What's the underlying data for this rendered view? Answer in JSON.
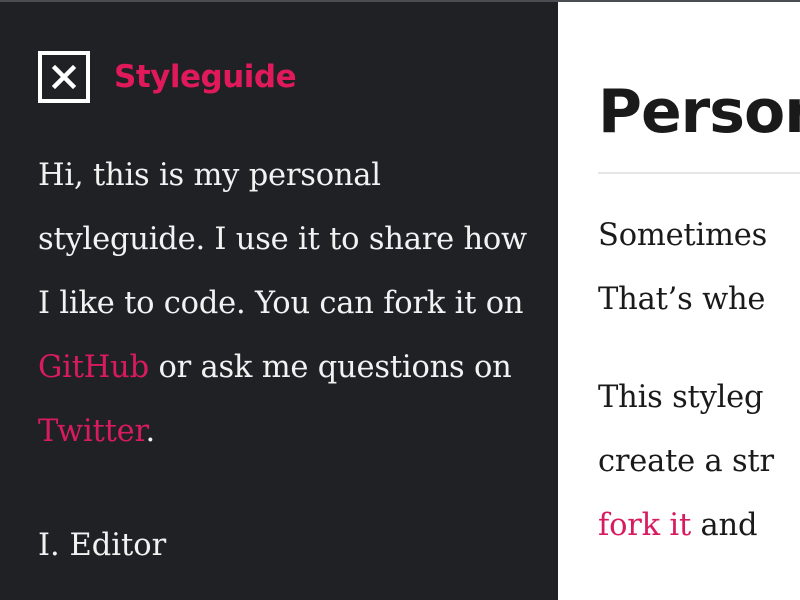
{
  "sidebar": {
    "brand": {
      "name": "Styleguide",
      "logo_icon": "close-box-icon",
      "accent_color": "#e0195b"
    },
    "intro": {
      "part1": "Hi, this is my personal styleguide. I use it to share how I like to code. You can fork it on ",
      "github_link": "GitHub",
      "part2": " or ask me questions on ",
      "twitter_link": "Twitter",
      "part3": "."
    },
    "author": "I. Editor"
  },
  "main": {
    "title": "Persor",
    "paragraph1": {
      "line1": "Sometimes",
      "line2": "That’s whe"
    },
    "paragraph2": {
      "line1": "This styleg",
      "line2": "create a str",
      "link": "fork it",
      "line3_rest": " and"
    }
  },
  "colors": {
    "sidebar_bg": "#1f2124",
    "link": "#d81b60",
    "text_dark": "#1a1a1a",
    "text_light": "#f2f2f2"
  }
}
